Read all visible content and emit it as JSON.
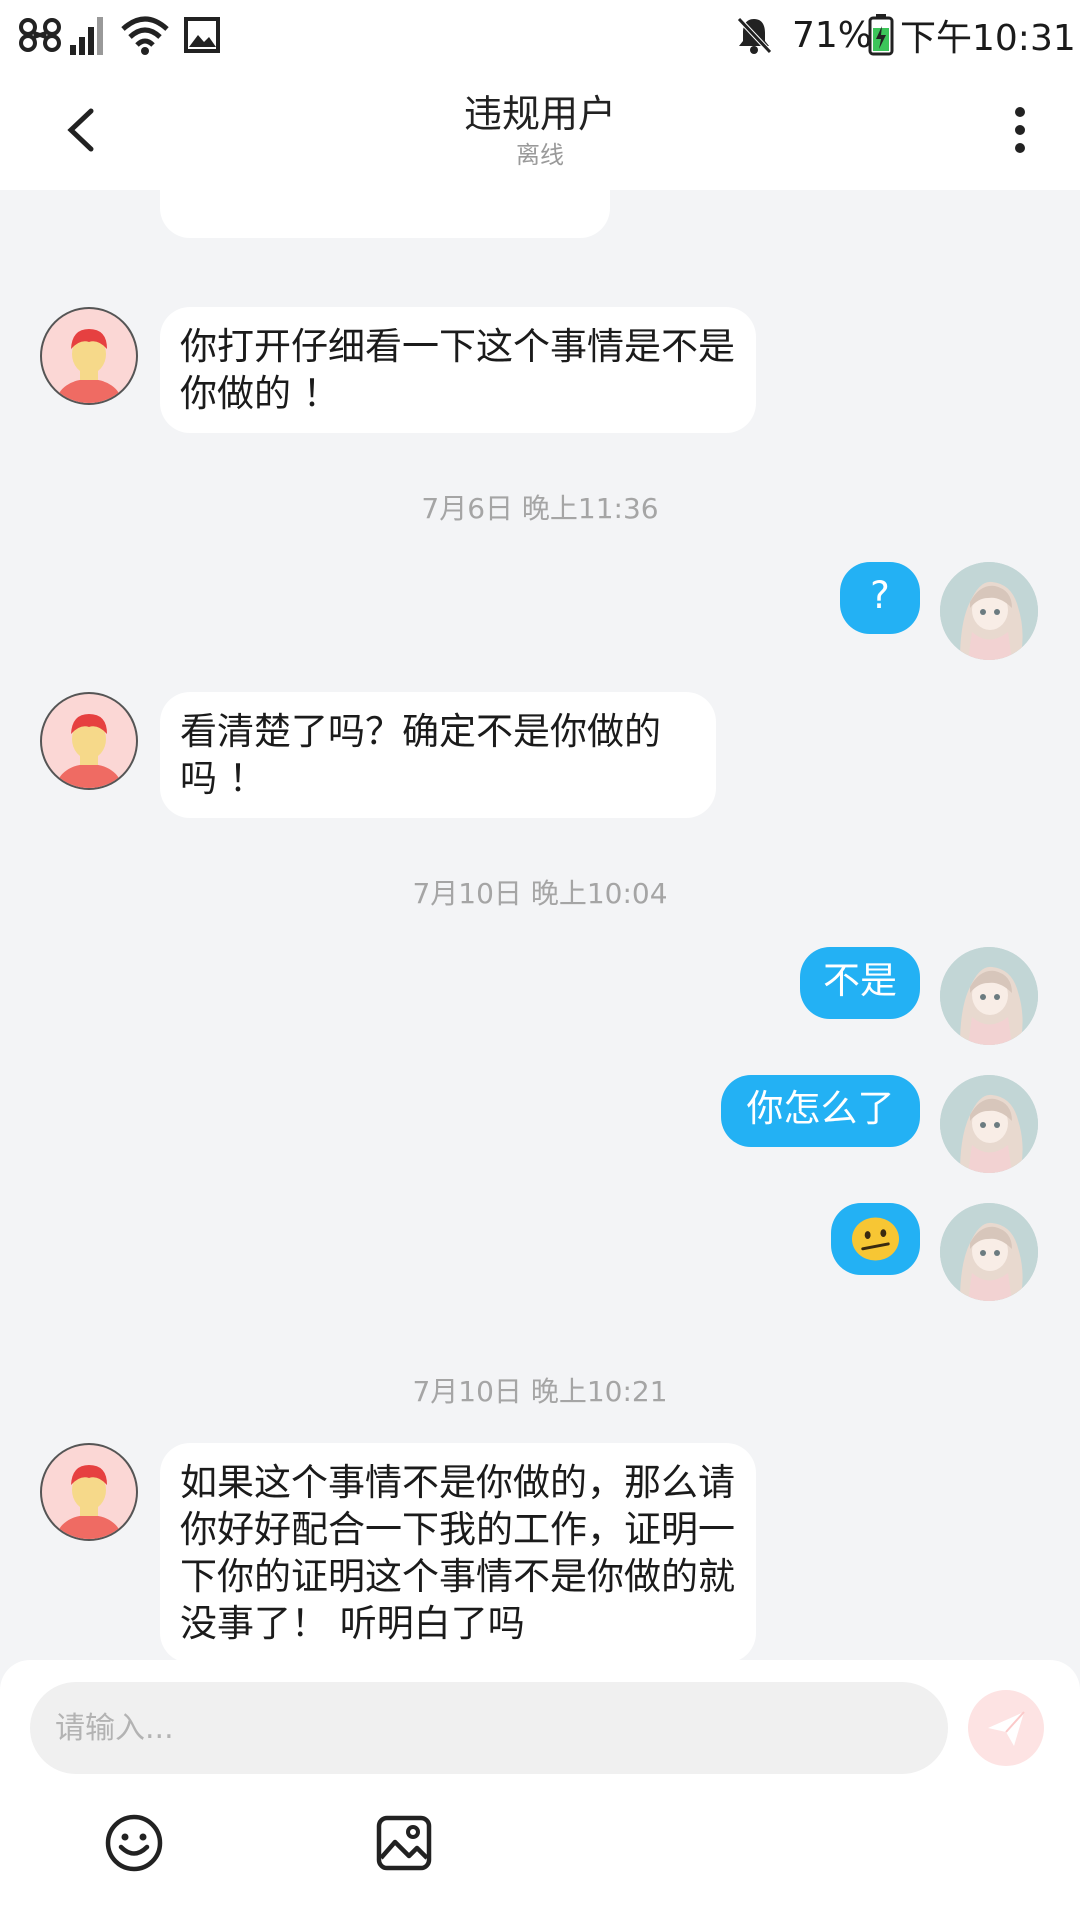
{
  "status_bar": {
    "battery": "71%",
    "time": "下午10:31"
  },
  "header": {
    "title": "违规用户",
    "subtitle": "离线"
  },
  "messages": [
    {
      "from": "other",
      "text": "你打开仔细看一下这个事情是不是你做的 ！"
    },
    {
      "timestamp": "7月6日 晚上11:36"
    },
    {
      "from": "me",
      "text": "?"
    },
    {
      "from": "other",
      "text": "看清楚了吗？确定不是你做的吗 ！"
    },
    {
      "timestamp": "7月10日 晚上10:04"
    },
    {
      "from": "me",
      "text": "不是"
    },
    {
      "from": "me",
      "text": "你怎么了"
    },
    {
      "from": "me",
      "emoji": "confused-face"
    },
    {
      "timestamp": "7月10日 晚上10:21"
    },
    {
      "from": "other",
      "text": "如果这个事情不是你做的，那么请你好好配合一下我的工作，证明一下你的证明这个事情不是你做的就没事了！ 听明白了吗"
    }
  ],
  "composer": {
    "placeholder": "请输入...",
    "tools": [
      "emoji-icon",
      "image-icon"
    ],
    "send_icon": "paper-plane-icon"
  },
  "colors": {
    "my_bubble": "#23b1f4",
    "background": "#f3f4f6",
    "send_button": "#fde3e3"
  }
}
